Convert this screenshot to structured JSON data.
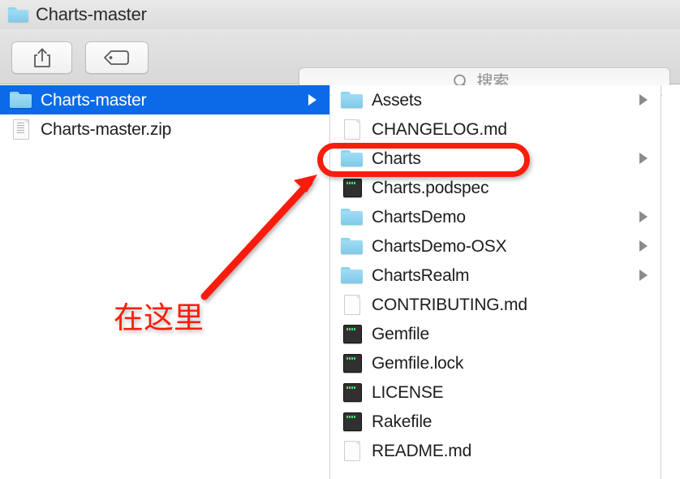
{
  "window": {
    "title": "Charts-master",
    "title_icon": "folder-icon"
  },
  "toolbar": {
    "share_button": {
      "name": "share-button",
      "icon": "share-icon"
    },
    "tag_button": {
      "name": "tag-button",
      "icon": "tag-icon"
    },
    "search": {
      "icon": "search-icon",
      "placeholder": "搜索",
      "value": ""
    }
  },
  "columns": {
    "left": {
      "items": [
        {
          "label": "Charts-master",
          "icon": "folder-icon",
          "selected": true,
          "has_children": true
        },
        {
          "label": "Charts-master.zip",
          "icon": "archive-icon",
          "selected": false,
          "has_children": false
        }
      ]
    },
    "right": {
      "items": [
        {
          "label": "Assets",
          "icon": "folder-icon",
          "selected": false,
          "has_children": true
        },
        {
          "label": "CHANGELOG.md",
          "icon": "document-icon",
          "selected": false,
          "has_children": false
        },
        {
          "label": "Charts",
          "icon": "folder-icon",
          "selected": false,
          "has_children": true
        },
        {
          "label": "Charts.podspec",
          "icon": "exec-icon",
          "selected": false,
          "has_children": false
        },
        {
          "label": "ChartsDemo",
          "icon": "folder-icon",
          "selected": false,
          "has_children": true
        },
        {
          "label": "ChartsDemo-OSX",
          "icon": "folder-icon",
          "selected": false,
          "has_children": true
        },
        {
          "label": "ChartsRealm",
          "icon": "folder-icon",
          "selected": false,
          "has_children": true
        },
        {
          "label": "CONTRIBUTING.md",
          "icon": "document-icon",
          "selected": false,
          "has_children": false
        },
        {
          "label": "Gemfile",
          "icon": "exec-icon",
          "selected": false,
          "has_children": false
        },
        {
          "label": "Gemfile.lock",
          "icon": "exec-icon",
          "selected": false,
          "has_children": false
        },
        {
          "label": "LICENSE",
          "icon": "exec-icon",
          "selected": false,
          "has_children": false
        },
        {
          "label": "Rakefile",
          "icon": "exec-icon",
          "selected": false,
          "has_children": false
        },
        {
          "label": "README.md",
          "icon": "document-icon",
          "selected": false,
          "has_children": false
        }
      ]
    }
  },
  "annotation": {
    "text": "在这里",
    "color": "#f91d0e",
    "highlight_target": "Charts",
    "arrow": "arrow-pointing-up-right"
  },
  "colors": {
    "selection_blue": "#0b6ae8",
    "folder_blue": "#8ed4ef",
    "annotation_red": "#f91d0e",
    "chrome_gray": "#dcdcdc"
  }
}
